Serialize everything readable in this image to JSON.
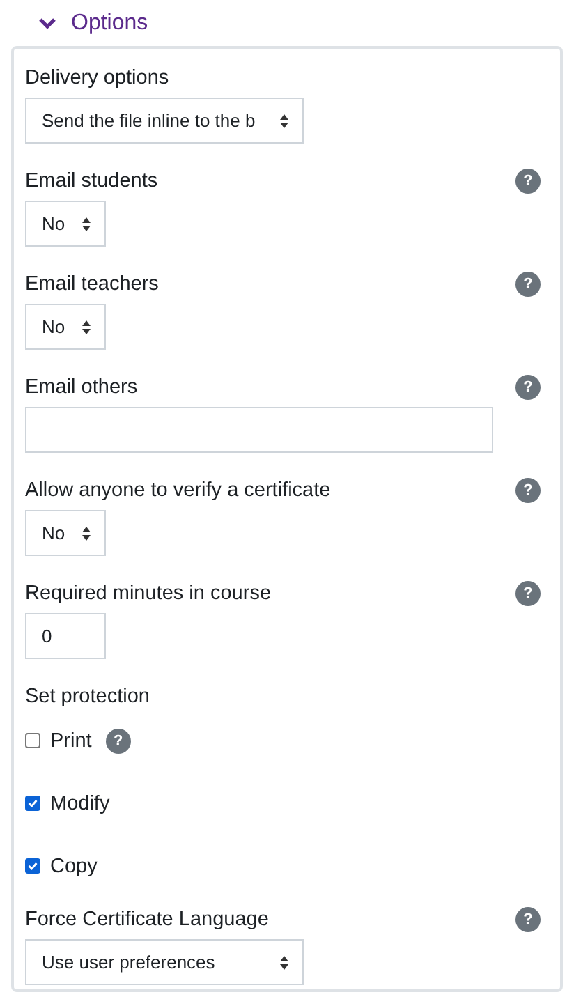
{
  "section": {
    "title": "Options",
    "expanded": true
  },
  "fields": [
    {
      "kind": "wide-select",
      "label": "Delivery options",
      "value": "Send the file inline to the b"
    },
    {
      "kind": "select",
      "label": "Email students",
      "value": "No",
      "help": "?"
    },
    {
      "kind": "select",
      "label": "Email teachers",
      "value": "No",
      "help": "?"
    },
    {
      "kind": "text",
      "label": "Email others",
      "help": "?"
    },
    {
      "kind": "select",
      "label": "Allow anyone to verify a certificate",
      "value": "No",
      "help": "?"
    },
    {
      "kind": "number",
      "label": "Required minutes in course",
      "value": "0",
      "help": "?"
    },
    {
      "kind": "checks",
      "label": "Set protection",
      "options": [
        {
          "label": "Print",
          "checked": false,
          "help": "?"
        },
        {
          "label": "Modify",
          "checked": true
        },
        {
          "label": "Copy",
          "checked": true
        }
      ]
    },
    {
      "kind": "wide-select",
      "label": "Force Certificate Language",
      "value": "Use user preferences",
      "help": "?"
    }
  ]
}
